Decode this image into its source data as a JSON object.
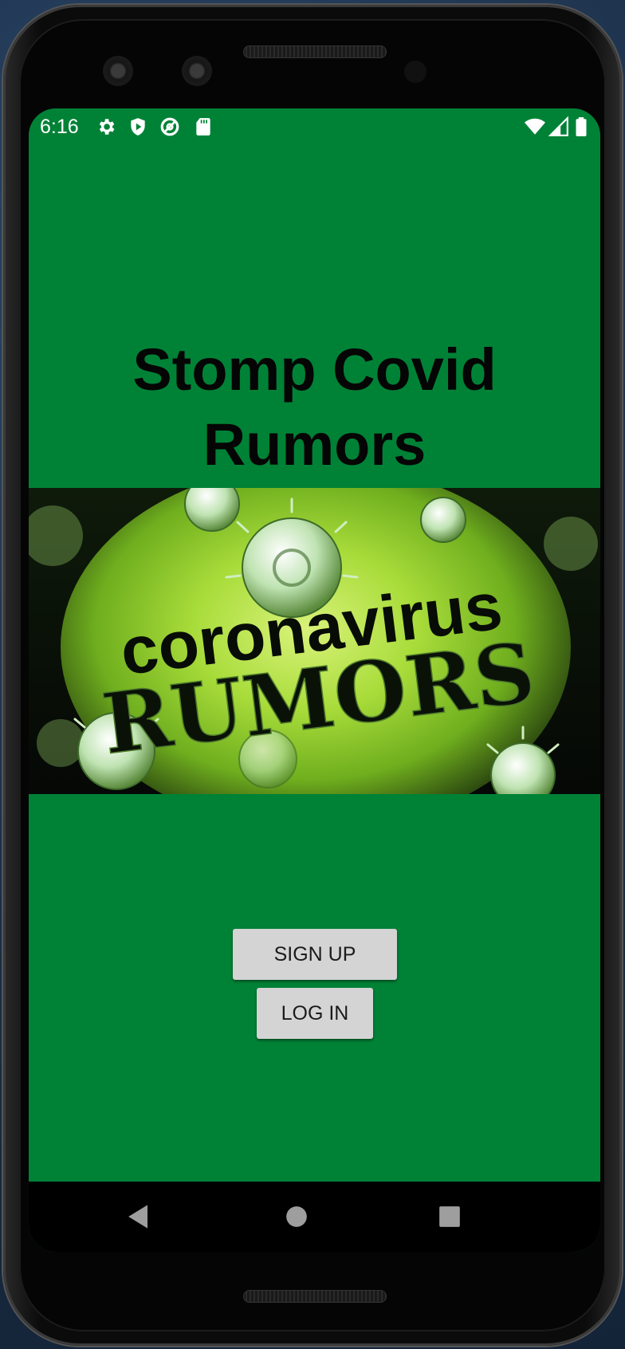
{
  "status_bar": {
    "time": "6:16",
    "left_icons": [
      "settings-icon",
      "shield-play-icon",
      "at-sign-icon",
      "sd-card-icon"
    ],
    "right_icons": [
      "wifi-icon",
      "signal-icon",
      "battery-icon"
    ]
  },
  "app": {
    "title": "Stomp Covid Rumors",
    "banner": {
      "line1": "coronavirus",
      "line2": "RUMORS"
    },
    "buttons": {
      "signup_label": "SIGN UP",
      "login_label": "LOG IN"
    },
    "colors": {
      "background": "#008236",
      "button": "#d4d4d4",
      "title": "#050505"
    }
  },
  "nav_bar": {
    "items": [
      "back-icon",
      "home-icon",
      "recents-icon"
    ]
  }
}
